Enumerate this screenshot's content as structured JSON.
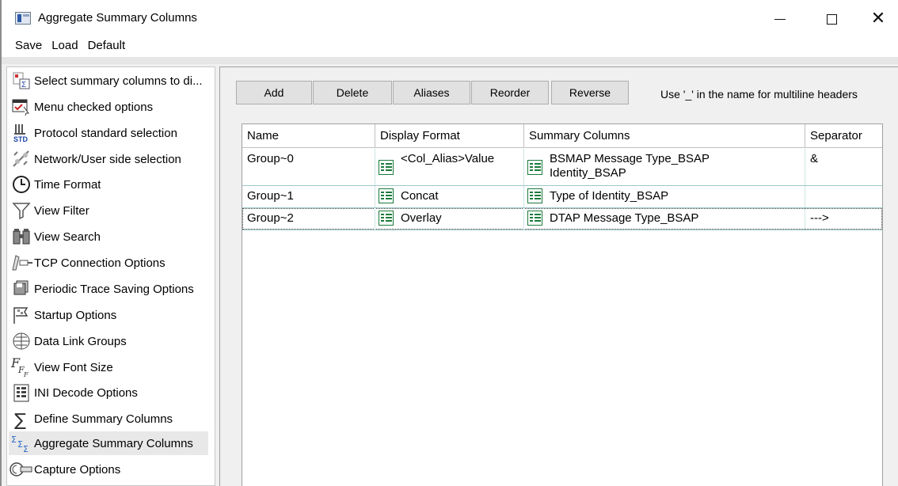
{
  "window": {
    "title": "Aggregate Summary Columns",
    "minimize": "—",
    "maximize": "☐",
    "close": "✕"
  },
  "menu": {
    "items": [
      "Save",
      "Load",
      "Default"
    ]
  },
  "sidebar": {
    "items": [
      {
        "label": "Select summary columns to di...",
        "icon": "summary-columns-icon"
      },
      {
        "label": "Menu checked options",
        "icon": "menu-options-icon"
      },
      {
        "label": "Protocol standard selection",
        "icon": "protocol-std-icon"
      },
      {
        "label": "Network/User side selection",
        "icon": "network-side-icon"
      },
      {
        "label": "Time Format",
        "icon": "clock-icon"
      },
      {
        "label": "View Filter",
        "icon": "filter-icon"
      },
      {
        "label": "View Search",
        "icon": "binoculars-icon"
      },
      {
        "label": "TCP Connection Options",
        "icon": "tcp-connection-icon"
      },
      {
        "label": "Periodic Trace Saving Options",
        "icon": "save-trace-icon"
      },
      {
        "label": "Startup Options",
        "icon": "startup-icon"
      },
      {
        "label": "Data Link Groups",
        "icon": "data-link-icon"
      },
      {
        "label": "View Font Size",
        "icon": "font-size-icon"
      },
      {
        "label": "INI Decode Options",
        "icon": "ini-decode-icon"
      },
      {
        "label": "Define Summary Columns",
        "icon": "sigma-icon"
      },
      {
        "label": "Aggregate Summary Columns",
        "icon": "aggregate-sigma-icon"
      },
      {
        "label": "Capture Options",
        "icon": "capture-icon"
      }
    ],
    "selected_index": 14
  },
  "toolbar": {
    "add": "Add",
    "delete": "Delete",
    "aliases": "Aliases",
    "reorder": "Reorder",
    "reverse": "Reverse",
    "hint": "Use '_' in the name for multiline headers"
  },
  "grid": {
    "headers": [
      "Name",
      "Display Format",
      "Summary Columns",
      "Separator"
    ],
    "rows": [
      {
        "name": "Group~0",
        "format": "<Col_Alias>Value",
        "columns_line1": "BSMAP Message Type_BSAP",
        "columns_line2": "Identity_BSAP",
        "separator": "&"
      },
      {
        "name": "Group~1",
        "format": "Concat",
        "columns_line1": "Type of Identity_BSAP",
        "columns_line2": "",
        "separator": ""
      },
      {
        "name": "Group~2",
        "format": "Overlay",
        "columns_line1": "DTAP Message Type_BSAP",
        "columns_line2": "",
        "separator": "--->"
      }
    ],
    "selected_row": 2
  }
}
